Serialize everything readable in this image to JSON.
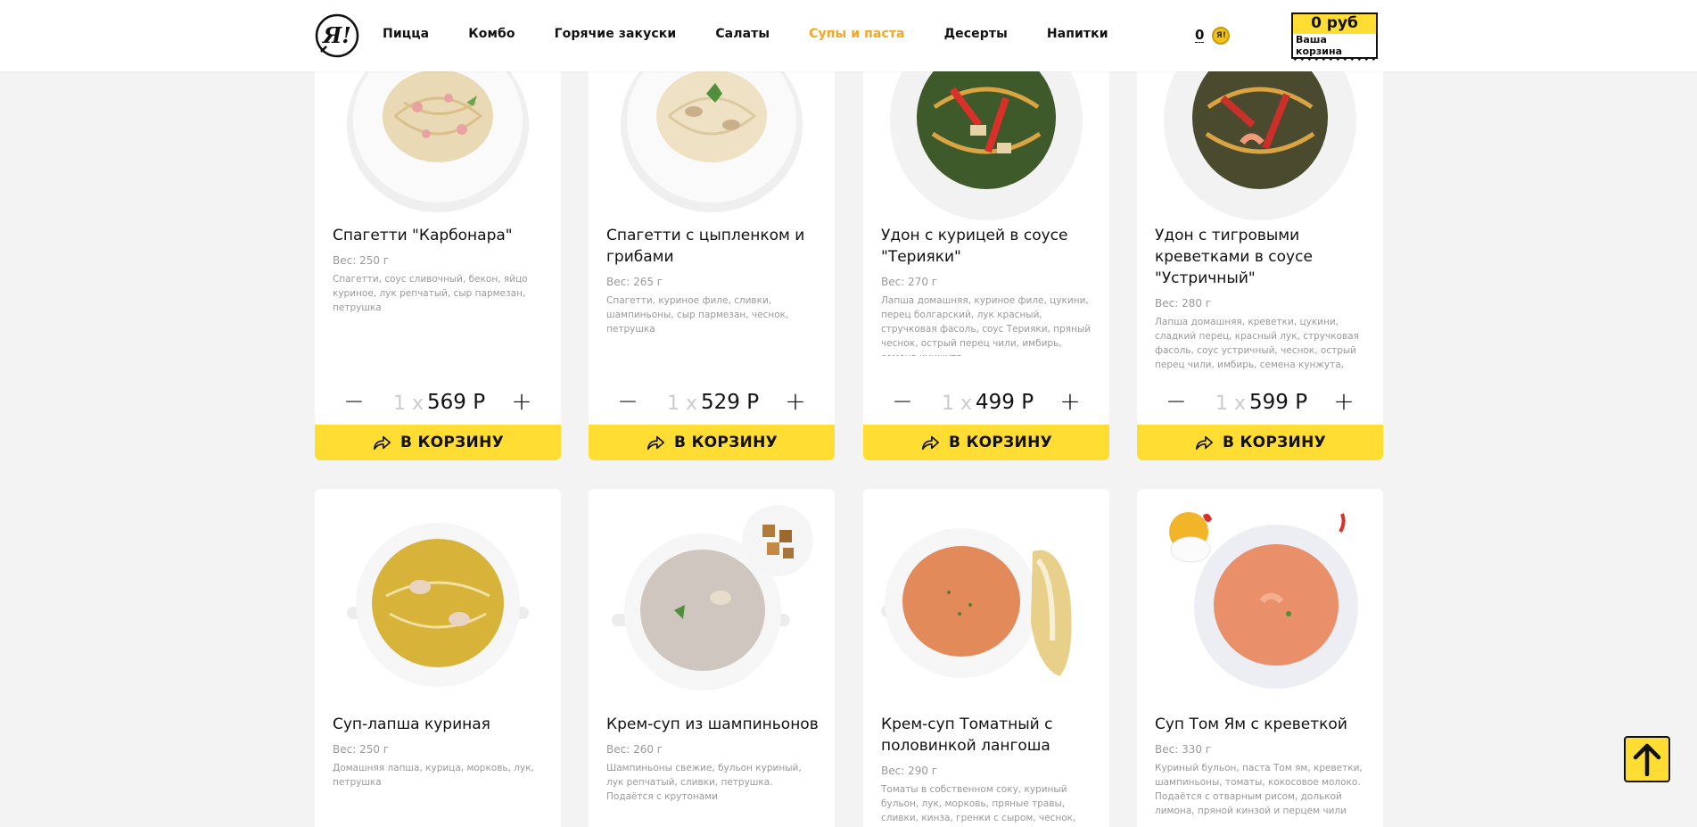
{
  "header": {
    "logo_text": "Я!",
    "nav": [
      {
        "label": "Пицца",
        "active": false
      },
      {
        "label": "Комбо",
        "active": false
      },
      {
        "label": "Горячие закуски",
        "active": false
      },
      {
        "label": "Салаты",
        "active": false
      },
      {
        "label": "Супы и паста",
        "active": true
      },
      {
        "label": "Десерты",
        "active": false
      },
      {
        "label": "Напитки",
        "active": false
      }
    ],
    "coins_count": "0",
    "coin_icon_text": "Я!",
    "cart_sum": "0 руб",
    "cart_label": "Ваша корзина"
  },
  "add_to_cart_label": "В КОРЗИНУ",
  "qty_prefix": "1 x",
  "products": [
    {
      "name": "Спагетти \"Карбонара\"",
      "weight": "Вес: 250 г",
      "description": "Спагетти, соус сливочный, бекон, яйцо куриное, лук репчатый, сыр пармезан, петрушка",
      "price": "569 Р",
      "image": "pasta-carbonara"
    },
    {
      "name": "Спагетти с цыпленком и грибами",
      "weight": "Вес: 265 г",
      "description": "Спагетти, куриное филе, сливки, шампиньоны, сыр пармезан, чеснок, петрушка",
      "price": "529 Р",
      "image": "pasta-chicken-mushroom"
    },
    {
      "name": "Удон с курицей в соусе \"Терияки\"",
      "weight": "Вес: 270 г",
      "description": "Лапша домашняя, куриное филе, цукини, перец болгарский, лук красный, стручковая фасоль, соус Терияки, пряный чеснок, острый перец чили, имбирь, семена кунжута",
      "price": "499 Р",
      "image": "udon-chicken"
    },
    {
      "name": "Удон с тигровыми креветками в соусе \"Устричный\"",
      "weight": "Вес: 280 г",
      "description": "Лапша домашняя, креветки, цукини, сладкий перец, красный лук, стручковая фасоль, соус устричный, чеснок, острый перец чили, имбирь, семена кунжута,",
      "price": "599 Р",
      "image": "udon-shrimp"
    },
    {
      "name": "Суп-лапша куриная",
      "weight": "Вес: 250 г",
      "description": "Домашняя лапша, курица, морковь, лук, петрушка",
      "image": "chicken-noodle-soup"
    },
    {
      "name": "Крем-суп из шампиньонов",
      "weight": "Вес: 260 г",
      "description": "Шампиньоны свежие, бульон куриный, лук репчатый, сливки, петрушка. Подаётся с крутонами",
      "image": "mushroom-soup"
    },
    {
      "name": "Крем-суп Томатный с половинкой лангоша",
      "weight": "Вес: 290 г",
      "description": "Томаты в собственном соку, куриный бульон, лук, морковь, пряные травы, сливки, кинза, гренки с сыром, чеснок,",
      "image": "tomato-soup"
    },
    {
      "name": "Суп Том Ям с креветкой",
      "weight": "Вес: 330 г",
      "description": "Куриный бульон, паста Том ям, креветки, шампиньоны, томаты, кокосовое молоко. Подаётся с отварным рисом, долькой лимона, пряной кинзой и перцем чили",
      "image": "tom-yam-soup"
    }
  ],
  "colors": {
    "accent": "#ffdd33",
    "active_nav": "#f5a623",
    "muted": "#999999"
  }
}
